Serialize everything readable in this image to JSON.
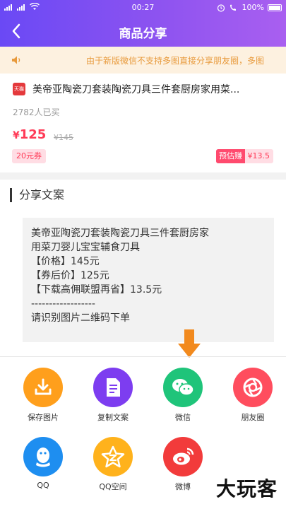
{
  "status_bar": {
    "time": "00:27",
    "battery": "100%"
  },
  "nav": {
    "title": "商品分享"
  },
  "notice": {
    "text": "由于新版微信不支持多图直接分享朋友圈，多图"
  },
  "product": {
    "badge": "天猫",
    "title": "美帝亚陶瓷刀套装陶瓷刀具三件套厨房家用菜...",
    "sold": "2782人已买",
    "currency": "¥",
    "price": "125",
    "original_price": "¥145",
    "coupon": "20元券",
    "earn_label": "预估赚",
    "earn_value": "¥13.5"
  },
  "share_copy": {
    "section_title": "分享文案",
    "lines": [
      "美帝亚陶瓷刀套装陶瓷刀具三件套厨房家",
      "用菜刀婴儿宝宝辅食刀具",
      "【价格】145元",
      "【券后价】125元",
      "【下载高佣联盟再省】13.5元",
      "------------------",
      "请识别图片二维码下单"
    ]
  },
  "share_options": [
    {
      "label": "保存图片",
      "icon": "download-icon",
      "color": "#ff9f1c"
    },
    {
      "label": "复制文案",
      "icon": "document-icon",
      "color": "#7d3df0"
    },
    {
      "label": "微信",
      "icon": "wechat-icon",
      "color": "#1fc47a"
    },
    {
      "label": "朋友圈",
      "icon": "moments-icon",
      "color": "#ff4d5e"
    },
    {
      "label": "QQ",
      "icon": "qq-icon",
      "color": "#1e8ef0"
    },
    {
      "label": "QQ空间",
      "icon": "qzone-icon",
      "color": "#ffb21c"
    },
    {
      "label": "微博",
      "icon": "weibo-icon",
      "color": "#f23b3b"
    }
  ],
  "watermark": "大玩客",
  "colors": {
    "accent": "#7a4ef3",
    "price": "#ff3b57",
    "notice": "#e89a3c",
    "arrow": "#f28a1e"
  }
}
